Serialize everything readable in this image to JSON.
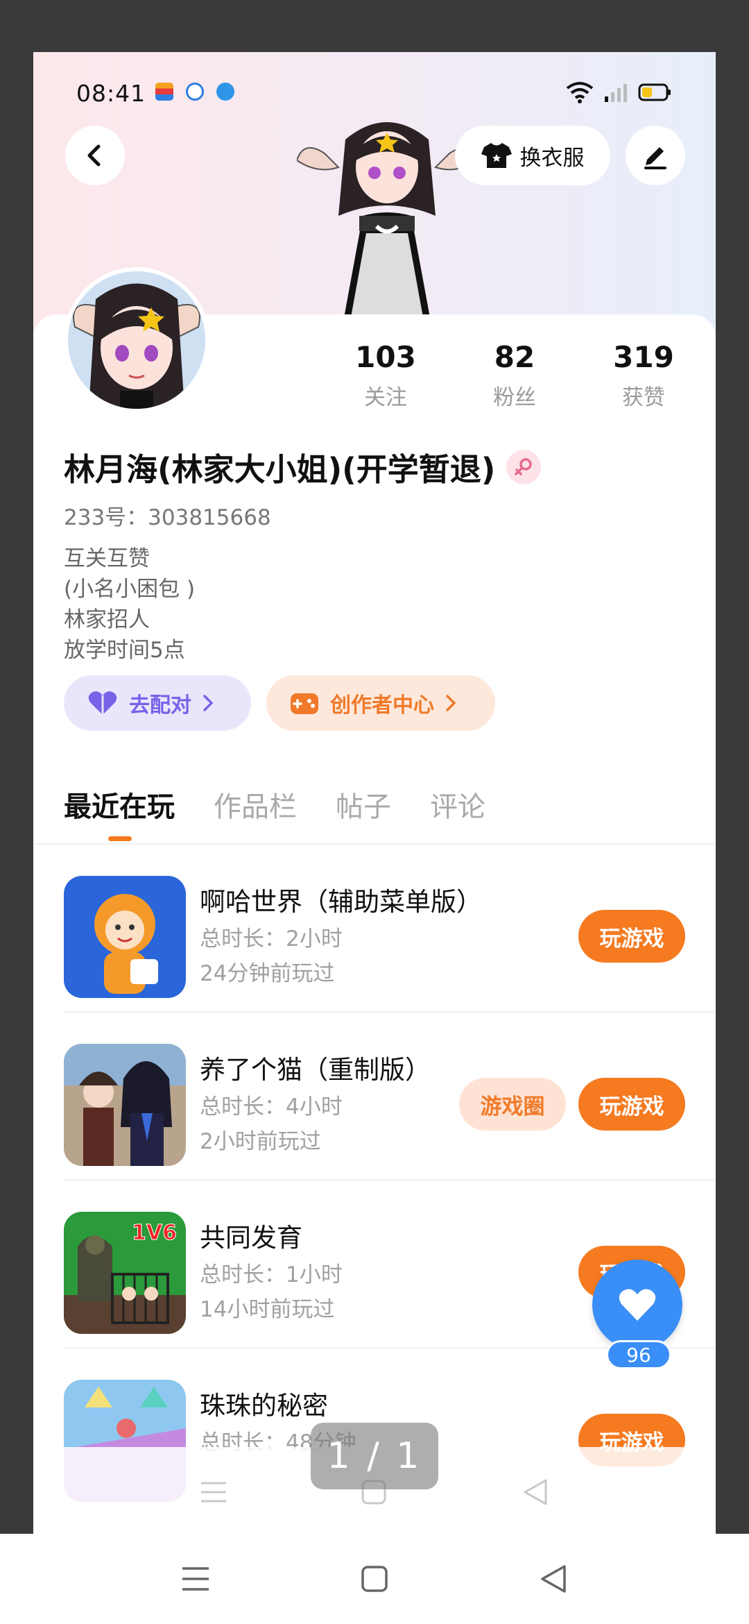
{
  "status_bar": {
    "time": "08:41"
  },
  "header": {
    "outfit_label": "换衣服"
  },
  "stats": [
    {
      "value": "103",
      "label": "关注"
    },
    {
      "value": "82",
      "label": "粉丝"
    },
    {
      "value": "319",
      "label": "获赞"
    }
  ],
  "profile": {
    "name": "林月海(林家大小姐)(开学暂退)",
    "uid": "233号：303815668",
    "bio": [
      "互关互赞",
      "(小名小困包 )",
      "林家招人",
      "放学时间5点"
    ]
  },
  "actions": {
    "match_label": "去配对",
    "creator_label": "创作者中心"
  },
  "tabs": [
    "最近在玩",
    "作品栏",
    "帖子",
    "评论"
  ],
  "games": [
    {
      "title": "啊哈世界（辅助菜单版）",
      "duration": "总时长：2小时",
      "last_played": "24分钟前玩过",
      "play_label": "玩游戏"
    },
    {
      "title": "养了个猫（重制版）",
      "duration": "总时长：4小时",
      "last_played": "2小时前玩过",
      "circle_label": "游戏圈",
      "play_label": "玩游戏"
    },
    {
      "title": "共同发育",
      "duration": "总时长：1小时",
      "last_played": "14小时前玩过",
      "play_label": "玩游戏",
      "badge_text": "1V6"
    },
    {
      "title": "珠珠的秘密",
      "duration": "总时长：48分钟",
      "play_label": "玩游戏"
    }
  ],
  "like_fab": {
    "count": "96"
  },
  "viewer": {
    "page_indicator": "1 / 1"
  },
  "colors": {
    "accent": "#f57a20",
    "fab": "#3a8ef7",
    "match": "#7762e8"
  }
}
